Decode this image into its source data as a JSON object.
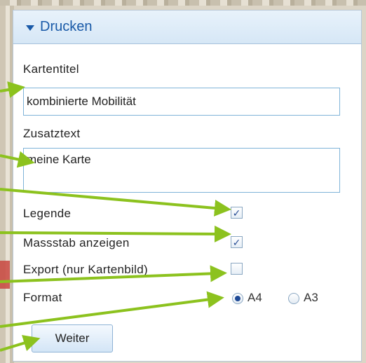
{
  "panel": {
    "title": "Drucken",
    "title_label": "Kartentitel",
    "title_value": "kombinierte Mobilität",
    "extra_label": "Zusatztext",
    "extra_value": "meine Karte",
    "legend_label": "Legende",
    "legend_checked": "✓",
    "scale_label": "Massstab anzeigen",
    "scale_checked": "✓",
    "export_label": "Export (nur Kartenbild)",
    "export_checked": "",
    "format_label": "Format",
    "format_options": [
      "A4",
      "A3"
    ],
    "format_selected": "A4",
    "submit_label": "Weiter"
  },
  "colors": {
    "accent": "#1a5aa8",
    "arrow": "#8cc21e",
    "field_border": "#7fb3d8"
  }
}
